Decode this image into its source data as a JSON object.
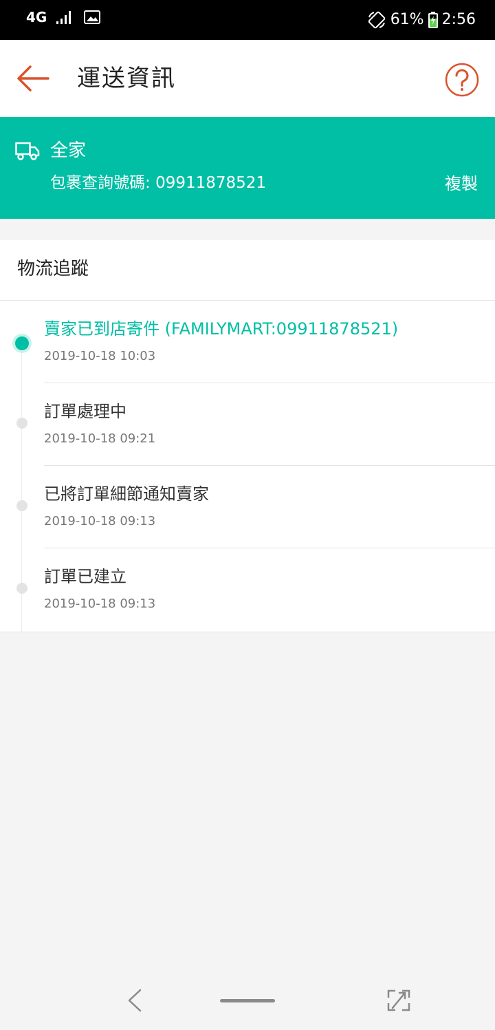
{
  "status_bar": {
    "network": "4G",
    "battery": "61%",
    "time": "2:56"
  },
  "header": {
    "title": "運送資訊",
    "back_icon": "arrow-left-icon",
    "help_icon": "question-circle-icon"
  },
  "carrier": {
    "icon": "truck-icon",
    "name": "全家",
    "tracking_label": "包裹查詢號碼:",
    "tracking_number": "09911878521",
    "copy_label": "複製",
    "background_color": "#00bfa5"
  },
  "tracking": {
    "section_title": "物流追蹤",
    "events": [
      {
        "title": "賣家已到店寄件 (FAMILYMART:09911878521)",
        "time": "2019-10-18 10:03"
      },
      {
        "title": "訂單處理中",
        "time": "2019-10-18 09:21"
      },
      {
        "title": "已將訂單細節通知賣家",
        "time": "2019-10-18 09:13"
      },
      {
        "title": "訂單已建立",
        "time": "2019-10-18 09:13"
      }
    ]
  },
  "colors": {
    "accent": "#00bfa5",
    "brand_orange": "#d9532c"
  }
}
